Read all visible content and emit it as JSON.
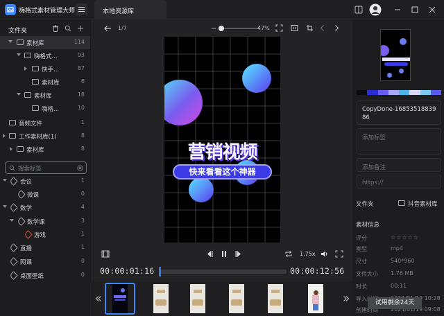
{
  "app": {
    "title": "嗨格式素材管理大师"
  },
  "tab": {
    "label": "本地资源库"
  },
  "sidebar": {
    "header": "文件夹",
    "tree": [
      {
        "label": "素材库",
        "count": "114"
      },
      {
        "label": "嗨格式...",
        "count": "93"
      },
      {
        "label": "快手...",
        "count": "87"
      },
      {
        "label": "素材库",
        "count": "6"
      },
      {
        "label": "素材库",
        "count": "18"
      },
      {
        "label": "嗨格...",
        "count": "10"
      },
      {
        "label": "音频文件",
        "count": "1"
      },
      {
        "label": "工作素材库(1)",
        "count": "8"
      },
      {
        "label": "素材库",
        "count": "8"
      }
    ],
    "search_placeholder": "搜索标签",
    "tags": [
      {
        "label": "会议",
        "count": "1"
      },
      {
        "label": "微课",
        "count": "0"
      },
      {
        "label": "数学",
        "count": "4"
      },
      {
        "label": "数学课",
        "count": "3"
      },
      {
        "label": "游戏",
        "count": "1"
      },
      {
        "label": "直播",
        "count": "1"
      },
      {
        "label": "网课",
        "count": "0"
      },
      {
        "label": "桌面壁纸",
        "count": "0"
      }
    ]
  },
  "viewer": {
    "page": "1/7",
    "zoom": "47%",
    "video_title": "营销视频",
    "video_subtitle": "快来看看这个神器",
    "speed": "1.75x",
    "time_current": "00:00:01:16",
    "time_total": "00:00:12:56",
    "progress": 0.0
  },
  "details": {
    "filename": "CopyDone-1685351883986",
    "tag_placeholder": "添加标签",
    "note_placeholder": "添加备注",
    "url_placeholder": "https://",
    "folder_label": "文件夹",
    "folder_value": "抖音素材库",
    "info_title": "素材信息",
    "info": [
      {
        "key": "评分",
        "value": "☆☆☆☆☆"
      },
      {
        "key": "类型",
        "value": "mp4"
      },
      {
        "key": "尺寸",
        "value": "540*960"
      },
      {
        "key": "文件大小",
        "value": "1.76 MB"
      },
      {
        "key": "时长",
        "value": "00:11"
      },
      {
        "key": "导入时间",
        "value": "2024/01/19 10:28"
      },
      {
        "key": "创建时间",
        "value": "2024/01/19 09:08"
      }
    ],
    "palette": [
      "#0b0b12",
      "#2b2bd6",
      "#6a5cf0",
      "#a9a7f7",
      "#4fb6e8",
      "#d8d8f5",
      "#7ec8f0",
      "#5a5af0"
    ]
  },
  "trial": {
    "label": "试用剩余24天"
  }
}
